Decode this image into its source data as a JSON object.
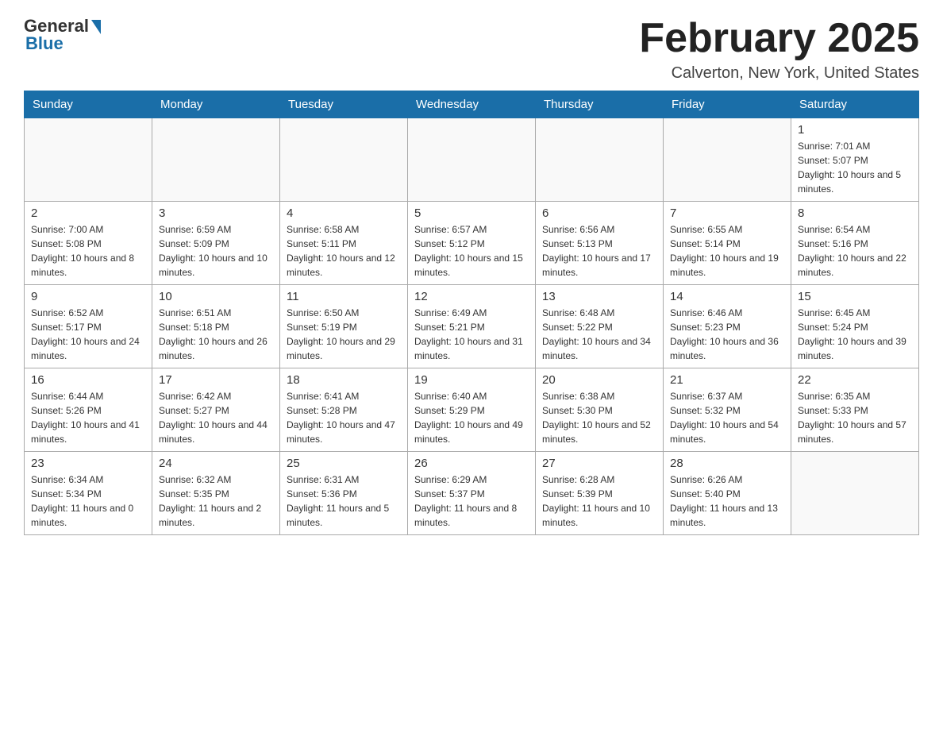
{
  "header": {
    "logo_general": "General",
    "logo_blue": "Blue",
    "month_title": "February 2025",
    "location": "Calverton, New York, United States"
  },
  "weekdays": [
    "Sunday",
    "Monday",
    "Tuesday",
    "Wednesday",
    "Thursday",
    "Friday",
    "Saturday"
  ],
  "weeks": [
    [
      {
        "day": "",
        "info": ""
      },
      {
        "day": "",
        "info": ""
      },
      {
        "day": "",
        "info": ""
      },
      {
        "day": "",
        "info": ""
      },
      {
        "day": "",
        "info": ""
      },
      {
        "day": "",
        "info": ""
      },
      {
        "day": "1",
        "info": "Sunrise: 7:01 AM\nSunset: 5:07 PM\nDaylight: 10 hours and 5 minutes."
      }
    ],
    [
      {
        "day": "2",
        "info": "Sunrise: 7:00 AM\nSunset: 5:08 PM\nDaylight: 10 hours and 8 minutes."
      },
      {
        "day": "3",
        "info": "Sunrise: 6:59 AM\nSunset: 5:09 PM\nDaylight: 10 hours and 10 minutes."
      },
      {
        "day": "4",
        "info": "Sunrise: 6:58 AM\nSunset: 5:11 PM\nDaylight: 10 hours and 12 minutes."
      },
      {
        "day": "5",
        "info": "Sunrise: 6:57 AM\nSunset: 5:12 PM\nDaylight: 10 hours and 15 minutes."
      },
      {
        "day": "6",
        "info": "Sunrise: 6:56 AM\nSunset: 5:13 PM\nDaylight: 10 hours and 17 minutes."
      },
      {
        "day": "7",
        "info": "Sunrise: 6:55 AM\nSunset: 5:14 PM\nDaylight: 10 hours and 19 minutes."
      },
      {
        "day": "8",
        "info": "Sunrise: 6:54 AM\nSunset: 5:16 PM\nDaylight: 10 hours and 22 minutes."
      }
    ],
    [
      {
        "day": "9",
        "info": "Sunrise: 6:52 AM\nSunset: 5:17 PM\nDaylight: 10 hours and 24 minutes."
      },
      {
        "day": "10",
        "info": "Sunrise: 6:51 AM\nSunset: 5:18 PM\nDaylight: 10 hours and 26 minutes."
      },
      {
        "day": "11",
        "info": "Sunrise: 6:50 AM\nSunset: 5:19 PM\nDaylight: 10 hours and 29 minutes."
      },
      {
        "day": "12",
        "info": "Sunrise: 6:49 AM\nSunset: 5:21 PM\nDaylight: 10 hours and 31 minutes."
      },
      {
        "day": "13",
        "info": "Sunrise: 6:48 AM\nSunset: 5:22 PM\nDaylight: 10 hours and 34 minutes."
      },
      {
        "day": "14",
        "info": "Sunrise: 6:46 AM\nSunset: 5:23 PM\nDaylight: 10 hours and 36 minutes."
      },
      {
        "day": "15",
        "info": "Sunrise: 6:45 AM\nSunset: 5:24 PM\nDaylight: 10 hours and 39 minutes."
      }
    ],
    [
      {
        "day": "16",
        "info": "Sunrise: 6:44 AM\nSunset: 5:26 PM\nDaylight: 10 hours and 41 minutes."
      },
      {
        "day": "17",
        "info": "Sunrise: 6:42 AM\nSunset: 5:27 PM\nDaylight: 10 hours and 44 minutes."
      },
      {
        "day": "18",
        "info": "Sunrise: 6:41 AM\nSunset: 5:28 PM\nDaylight: 10 hours and 47 minutes."
      },
      {
        "day": "19",
        "info": "Sunrise: 6:40 AM\nSunset: 5:29 PM\nDaylight: 10 hours and 49 minutes."
      },
      {
        "day": "20",
        "info": "Sunrise: 6:38 AM\nSunset: 5:30 PM\nDaylight: 10 hours and 52 minutes."
      },
      {
        "day": "21",
        "info": "Sunrise: 6:37 AM\nSunset: 5:32 PM\nDaylight: 10 hours and 54 minutes."
      },
      {
        "day": "22",
        "info": "Sunrise: 6:35 AM\nSunset: 5:33 PM\nDaylight: 10 hours and 57 minutes."
      }
    ],
    [
      {
        "day": "23",
        "info": "Sunrise: 6:34 AM\nSunset: 5:34 PM\nDaylight: 11 hours and 0 minutes."
      },
      {
        "day": "24",
        "info": "Sunrise: 6:32 AM\nSunset: 5:35 PM\nDaylight: 11 hours and 2 minutes."
      },
      {
        "day": "25",
        "info": "Sunrise: 6:31 AM\nSunset: 5:36 PM\nDaylight: 11 hours and 5 minutes."
      },
      {
        "day": "26",
        "info": "Sunrise: 6:29 AM\nSunset: 5:37 PM\nDaylight: 11 hours and 8 minutes."
      },
      {
        "day": "27",
        "info": "Sunrise: 6:28 AM\nSunset: 5:39 PM\nDaylight: 11 hours and 10 minutes."
      },
      {
        "day": "28",
        "info": "Sunrise: 6:26 AM\nSunset: 5:40 PM\nDaylight: 11 hours and 13 minutes."
      },
      {
        "day": "",
        "info": ""
      }
    ]
  ]
}
